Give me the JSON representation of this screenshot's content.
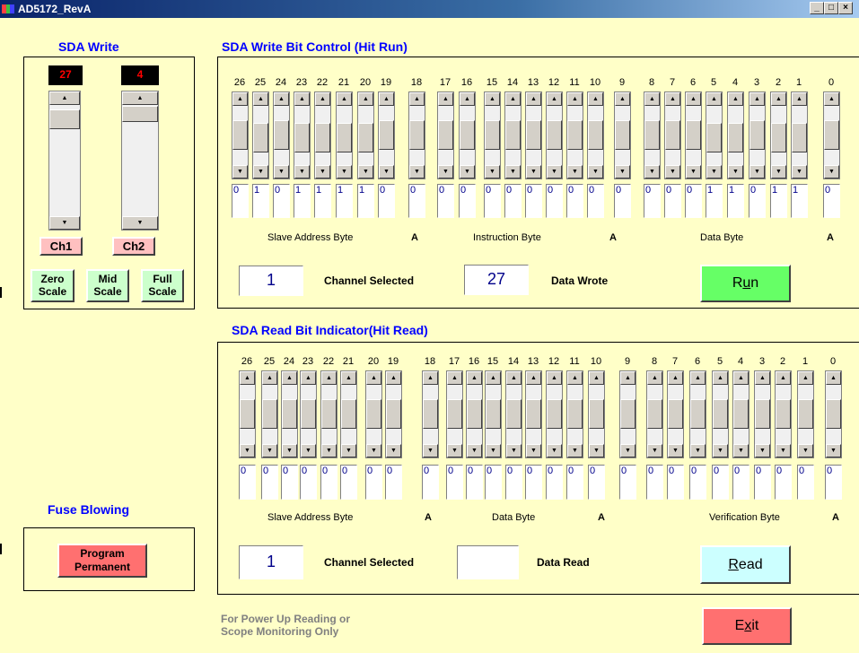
{
  "window": {
    "title": "AD5172_RevA",
    "buttons": [
      "_",
      "□",
      "×"
    ]
  },
  "sda_write": {
    "heading": "SDA Write",
    "ch1": {
      "value": "27",
      "label": "Ch1",
      "position": 0.1
    },
    "ch2": {
      "value": "4",
      "label": "Ch2",
      "position": 0.05
    },
    "buttons": [
      {
        "line1": "Zero",
        "line2": "Scale"
      },
      {
        "line1": "Mid",
        "line2": "Scale"
      },
      {
        "line1": "Full",
        "line2": "Scale"
      }
    ]
  },
  "write_panel": {
    "heading": "SDA Write Bit Control (Hit Run)",
    "bit_labels": [
      "26",
      "25",
      "24",
      "23",
      "22",
      "21",
      "20",
      "19",
      "18",
      "17",
      "16",
      "15",
      "14",
      "13",
      "12",
      "11",
      "10",
      "9",
      "8",
      "7",
      "6",
      "5",
      "4",
      "3",
      "2",
      "1",
      "0"
    ],
    "values": [
      "0",
      "1",
      "0",
      "1",
      "1",
      "1",
      "1",
      "0",
      "0",
      "0",
      "0",
      "0",
      "0",
      "0",
      "0",
      "0",
      "0",
      "0",
      "0",
      "0",
      "0",
      "1",
      "1",
      "0",
      "1",
      "1",
      "0"
    ],
    "sections": [
      "Slave Address Byte",
      "A",
      "Instruction Byte",
      "A",
      "Data Byte",
      "A"
    ],
    "channel_value": "1",
    "channel_label": "Channel Selected",
    "data_value": "27",
    "data_label": "Data Wrote",
    "run_label": "Run"
  },
  "read_panel": {
    "heading": "SDA Read Bit Indicator(Hit Read)",
    "bit_labels": [
      "26",
      "25",
      "24",
      "23",
      "22",
      "21",
      "20",
      "19",
      "18",
      "17",
      "16",
      "15",
      "14",
      "13",
      "12",
      "11",
      "10",
      "9",
      "8",
      "7",
      "6",
      "5",
      "4",
      "3",
      "2",
      "1",
      "0"
    ],
    "values": [
      "0",
      "0",
      "0",
      "0",
      "0",
      "0",
      "0",
      "0",
      "0",
      "0",
      "0",
      "0",
      "0",
      "0",
      "0",
      "0",
      "0",
      "0",
      "0",
      "0",
      "0",
      "0",
      "0",
      "0",
      "0",
      "0",
      "0"
    ],
    "sections": [
      "Slave Address Byte",
      "A",
      "Data Byte",
      "A",
      "Verification Byte",
      "A"
    ],
    "channel_value": "1",
    "channel_label": "Channel Selected",
    "data_value": "",
    "data_label": "Data Read",
    "read_label": "Read"
  },
  "fuse": {
    "heading": "Fuse Blowing",
    "button_line1": "Program",
    "button_line2": "Permanent"
  },
  "note": {
    "line1": "For Power Up Reading or",
    "line2": "Scope Monitoring Only"
  },
  "exit_label": "Exit",
  "colors": {
    "background": "#ffffc8",
    "heading": "#0000ff",
    "run": "#66ff66",
    "read": "#ccffff",
    "exit": "#ff7070",
    "channel_btn": "#ffc0c0",
    "scale_btn": "#ccffcc"
  }
}
